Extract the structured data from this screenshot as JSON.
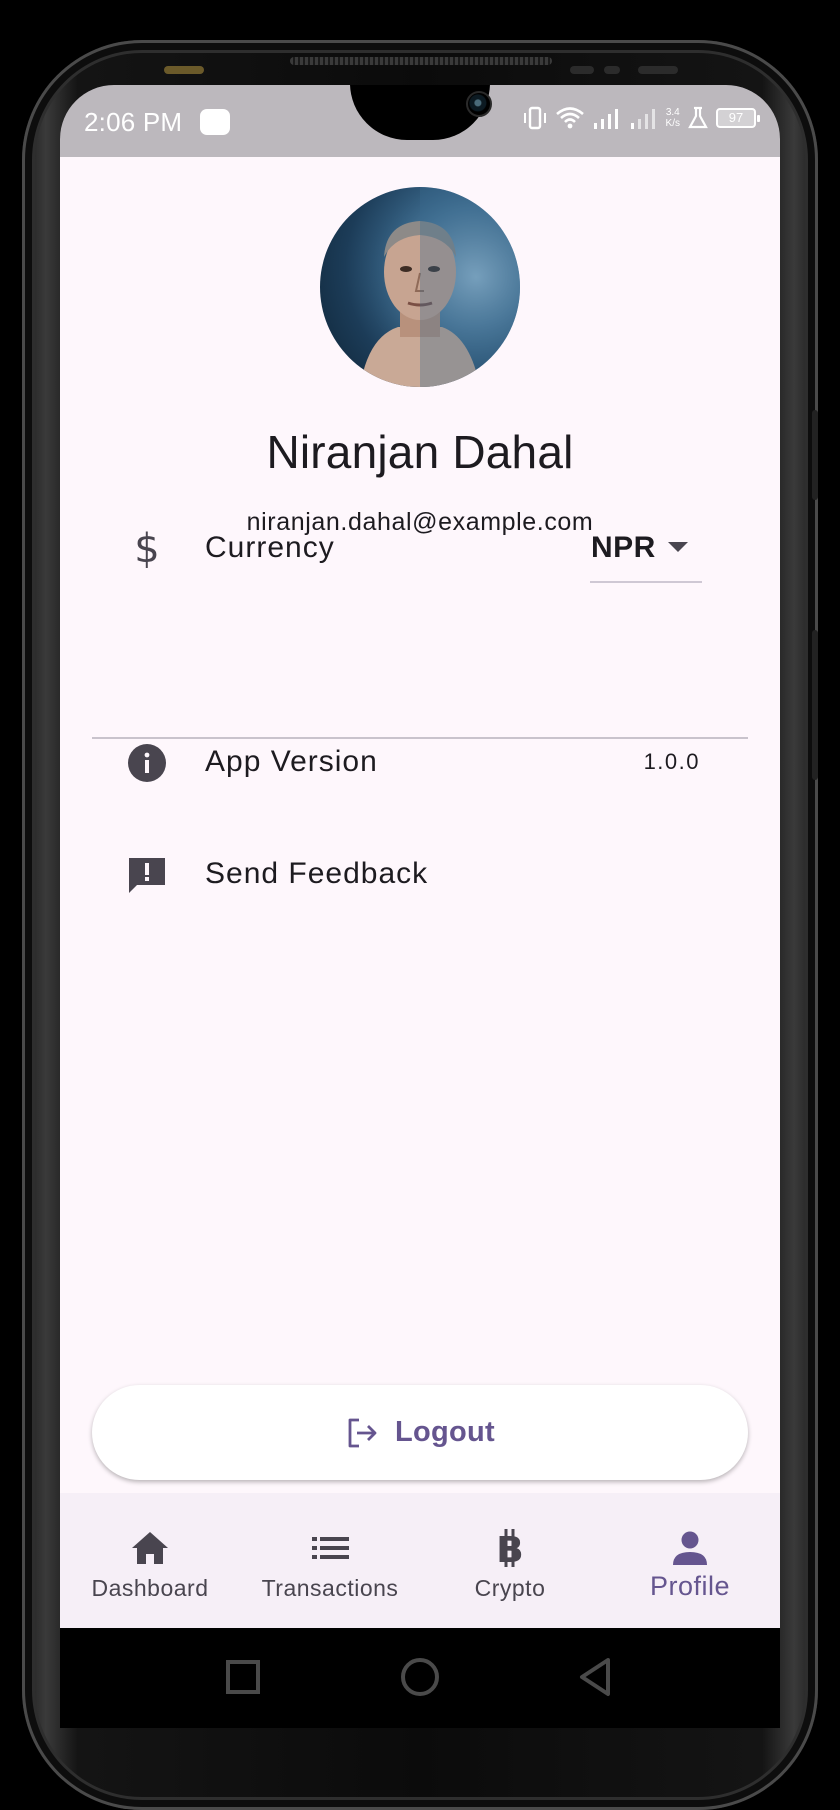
{
  "status_bar": {
    "time": "2:06 PM",
    "net_speed_value": "3.4",
    "net_speed_unit": "K/s",
    "battery_level": "97"
  },
  "profile": {
    "name": "Niranjan Dahal",
    "email": "niranjan.dahal@example.com"
  },
  "settings": {
    "currency": {
      "label": "Currency",
      "value": "NPR",
      "icon": "dollar-icon"
    },
    "app_version": {
      "label": "App Version",
      "value": "1.0.0",
      "icon": "info-icon"
    },
    "feedback": {
      "label": "Send Feedback",
      "icon": "feedback-icon"
    }
  },
  "logout": {
    "label": "Logout",
    "icon": "logout-icon"
  },
  "bottom_nav": {
    "items": [
      {
        "label": "Dashboard",
        "icon": "home-icon",
        "active": false
      },
      {
        "label": "Transactions",
        "icon": "list-icon",
        "active": false
      },
      {
        "label": "Crypto",
        "icon": "bitcoin-icon",
        "active": false
      },
      {
        "label": "Profile",
        "icon": "person-icon",
        "active": true
      }
    ]
  },
  "colors": {
    "accent": "#65558f",
    "background": "#fef7fc",
    "nav_background": "#f6eff7",
    "status_bar": "#bcb8bd",
    "text": "#1d1b20",
    "icon": "#49454f"
  }
}
